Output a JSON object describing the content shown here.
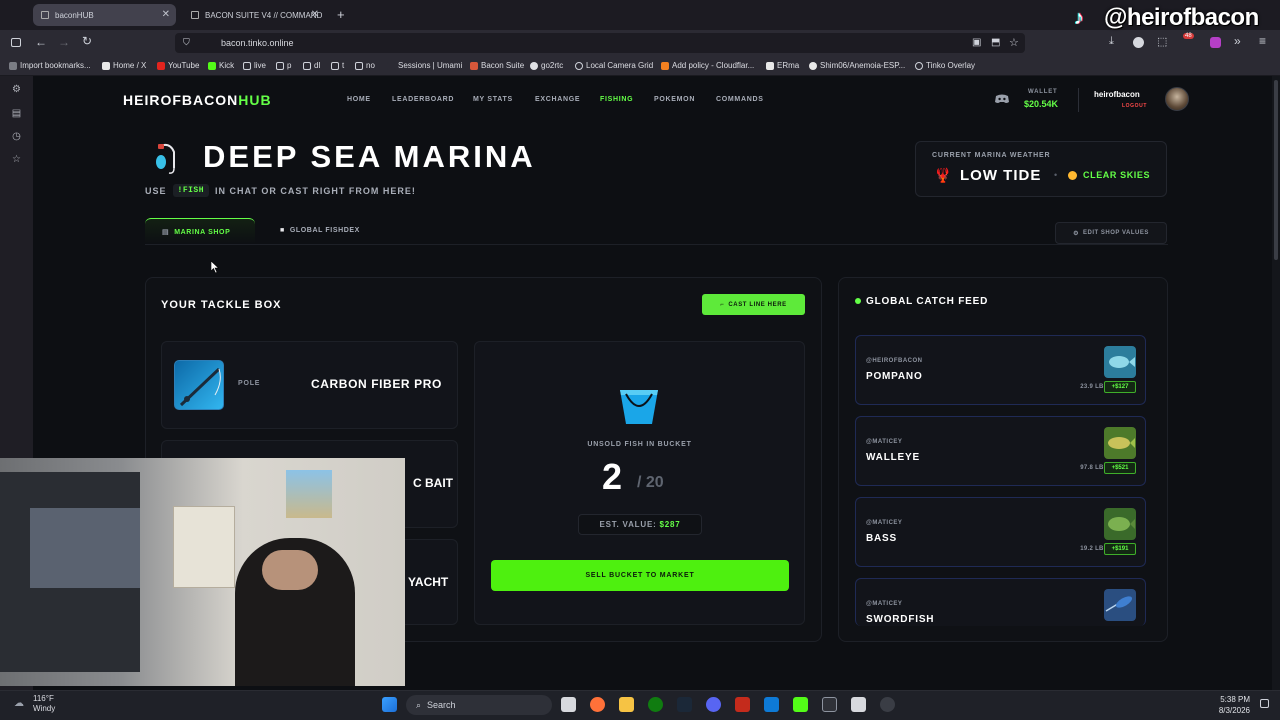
{
  "browser": {
    "tabs": [
      {
        "title": "baconHUB",
        "active": true
      },
      {
        "title": "BACON SUITE V4 // COMMAND",
        "active": false
      }
    ],
    "url": "bacon.tinko.online",
    "bookmarks": [
      "Import bookmarks...",
      "Home / X",
      "YouTube",
      "Kick",
      "live",
      "p",
      "dl",
      "t",
      "no",
      "Sessions | Umami",
      "Bacon Suite",
      "go2rtc",
      "Local Camera Grid",
      "Add policy - Cloudflar...",
      "ERma",
      "Shim06/Anemoia-ESP...",
      "Tinko Overlay"
    ],
    "ext_badge": "48"
  },
  "header": {
    "logo_main": "HEIROFBACON",
    "logo_accent": "HUB",
    "nav": [
      "HOME",
      "LEADERBOARD",
      "MY STATS",
      "EXCHANGE",
      "FISHING",
      "POKEMON",
      "COMMANDS"
    ],
    "active_nav": "FISHING",
    "wallet_label": "WALLET",
    "wallet_value": "$20.54K",
    "username": "heirofbacon",
    "logout": "LOGOUT"
  },
  "page": {
    "title": "DEEP SEA MARINA",
    "subtitle_prefix": "USE",
    "subtitle_code": "!FISH",
    "subtitle_suffix": "IN CHAT OR CAST RIGHT FROM HERE!",
    "weather_label": "CURRENT MARINA WEATHER",
    "tide": "LOW TIDE",
    "sky": "CLEAR SKIES",
    "tabs": [
      "MARINA SHOP",
      "GLOBAL FISHDEX"
    ],
    "edit_button": "EDIT SHOP VALUES"
  },
  "tackle": {
    "title": "YOUR TACKLE BOX",
    "cast_button": "CAST LINE HERE",
    "pole_type": "POLE",
    "pole_name": "CARBON FIBER PRO",
    "bait_name": "C BAIT",
    "boat_name": "YACHT"
  },
  "bucket": {
    "label": "UNSOLD FISH IN BUCKET",
    "count": "2",
    "capacity": "/ 20",
    "est_label": "EST. VALUE:",
    "est_value": "$287",
    "sell_button": "SELL BUCKET TO MARKET"
  },
  "feed": {
    "title": "GLOBAL CATCH FEED",
    "items": [
      {
        "user": "@HEIROFBACON",
        "fish": "POMPANO",
        "weight": "23.9 LBS",
        "price": "+$127",
        "color": "#8fd8e8"
      },
      {
        "user": "@MATICEY",
        "fish": "WALLEYE",
        "weight": "97.8 LBS",
        "price": "+$521",
        "color": "#9fc04a"
      },
      {
        "user": "@MATICEY",
        "fish": "BASS",
        "weight": "19.2 LBS",
        "price": "+$191",
        "color": "#7bb050"
      },
      {
        "user": "@MATICEY",
        "fish": "SWORDFISH",
        "weight": "",
        "price": "",
        "color": "#3f7fd0"
      }
    ]
  },
  "taskbar": {
    "weather_temp": "116°F",
    "weather_desc": "Windy",
    "search": "Search",
    "time": "5:38 PM",
    "date": "8/3/2026"
  },
  "watermark": "@heirofbacon"
}
